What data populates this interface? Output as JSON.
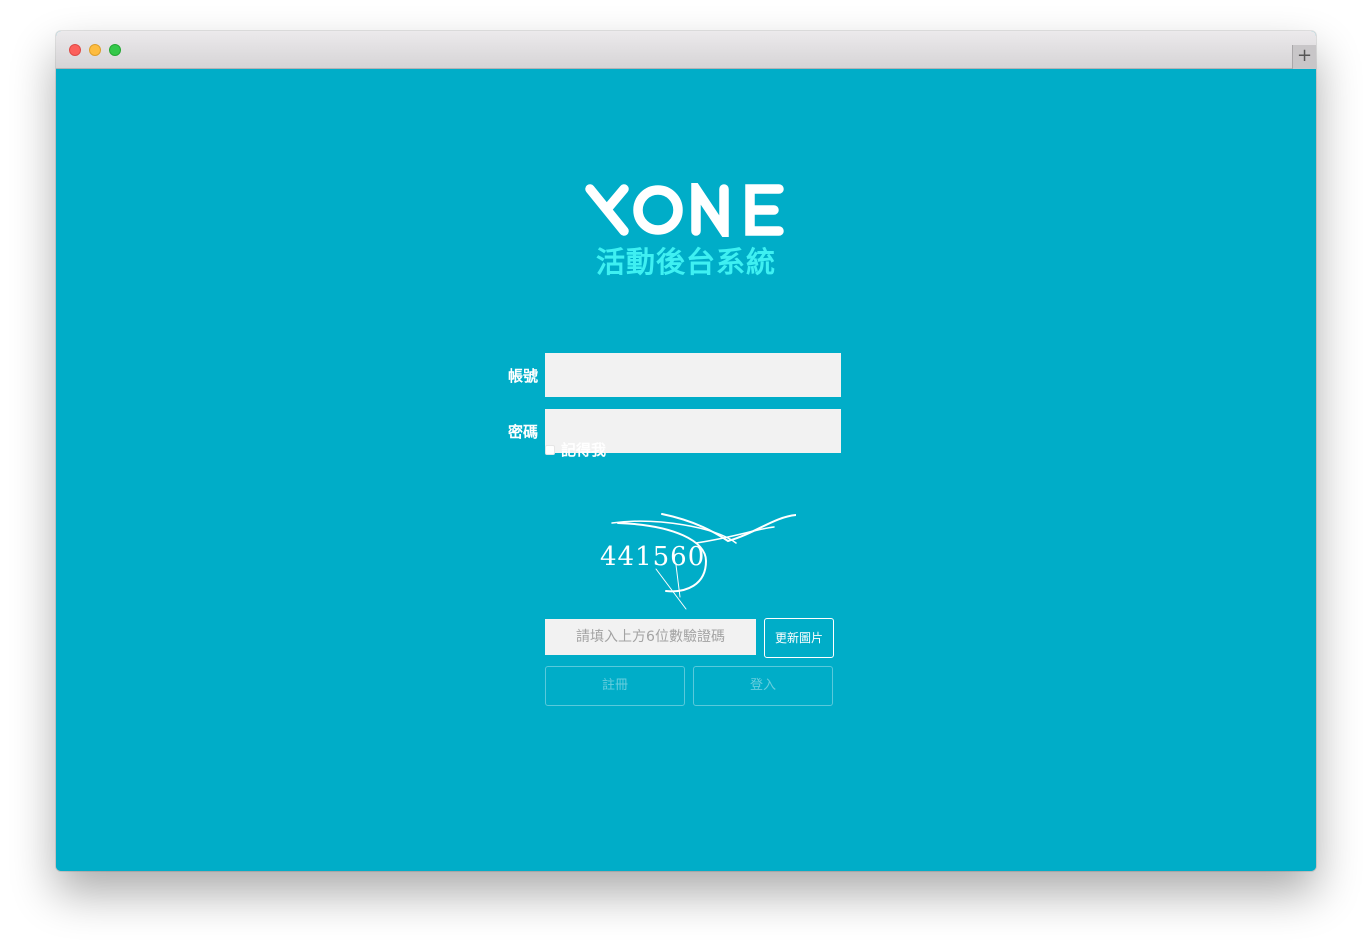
{
  "window": {
    "new_tab_symbol": "+"
  },
  "brand": {
    "logo_text": "XONE",
    "subtitle": "活動後台系統",
    "subtitle_color": "#3ef0f2",
    "background_color": "#00adc8"
  },
  "form": {
    "account_label": "帳號",
    "account_value": "",
    "password_label": "密碼",
    "password_value": "",
    "remember_label": "記得我",
    "remember_checked": false,
    "captcha_text": "441560",
    "captcha_placeholder": "請填入上方6位數驗證碼",
    "refresh_label": "更新圖片",
    "register_label": "註冊",
    "login_label": "登入"
  }
}
